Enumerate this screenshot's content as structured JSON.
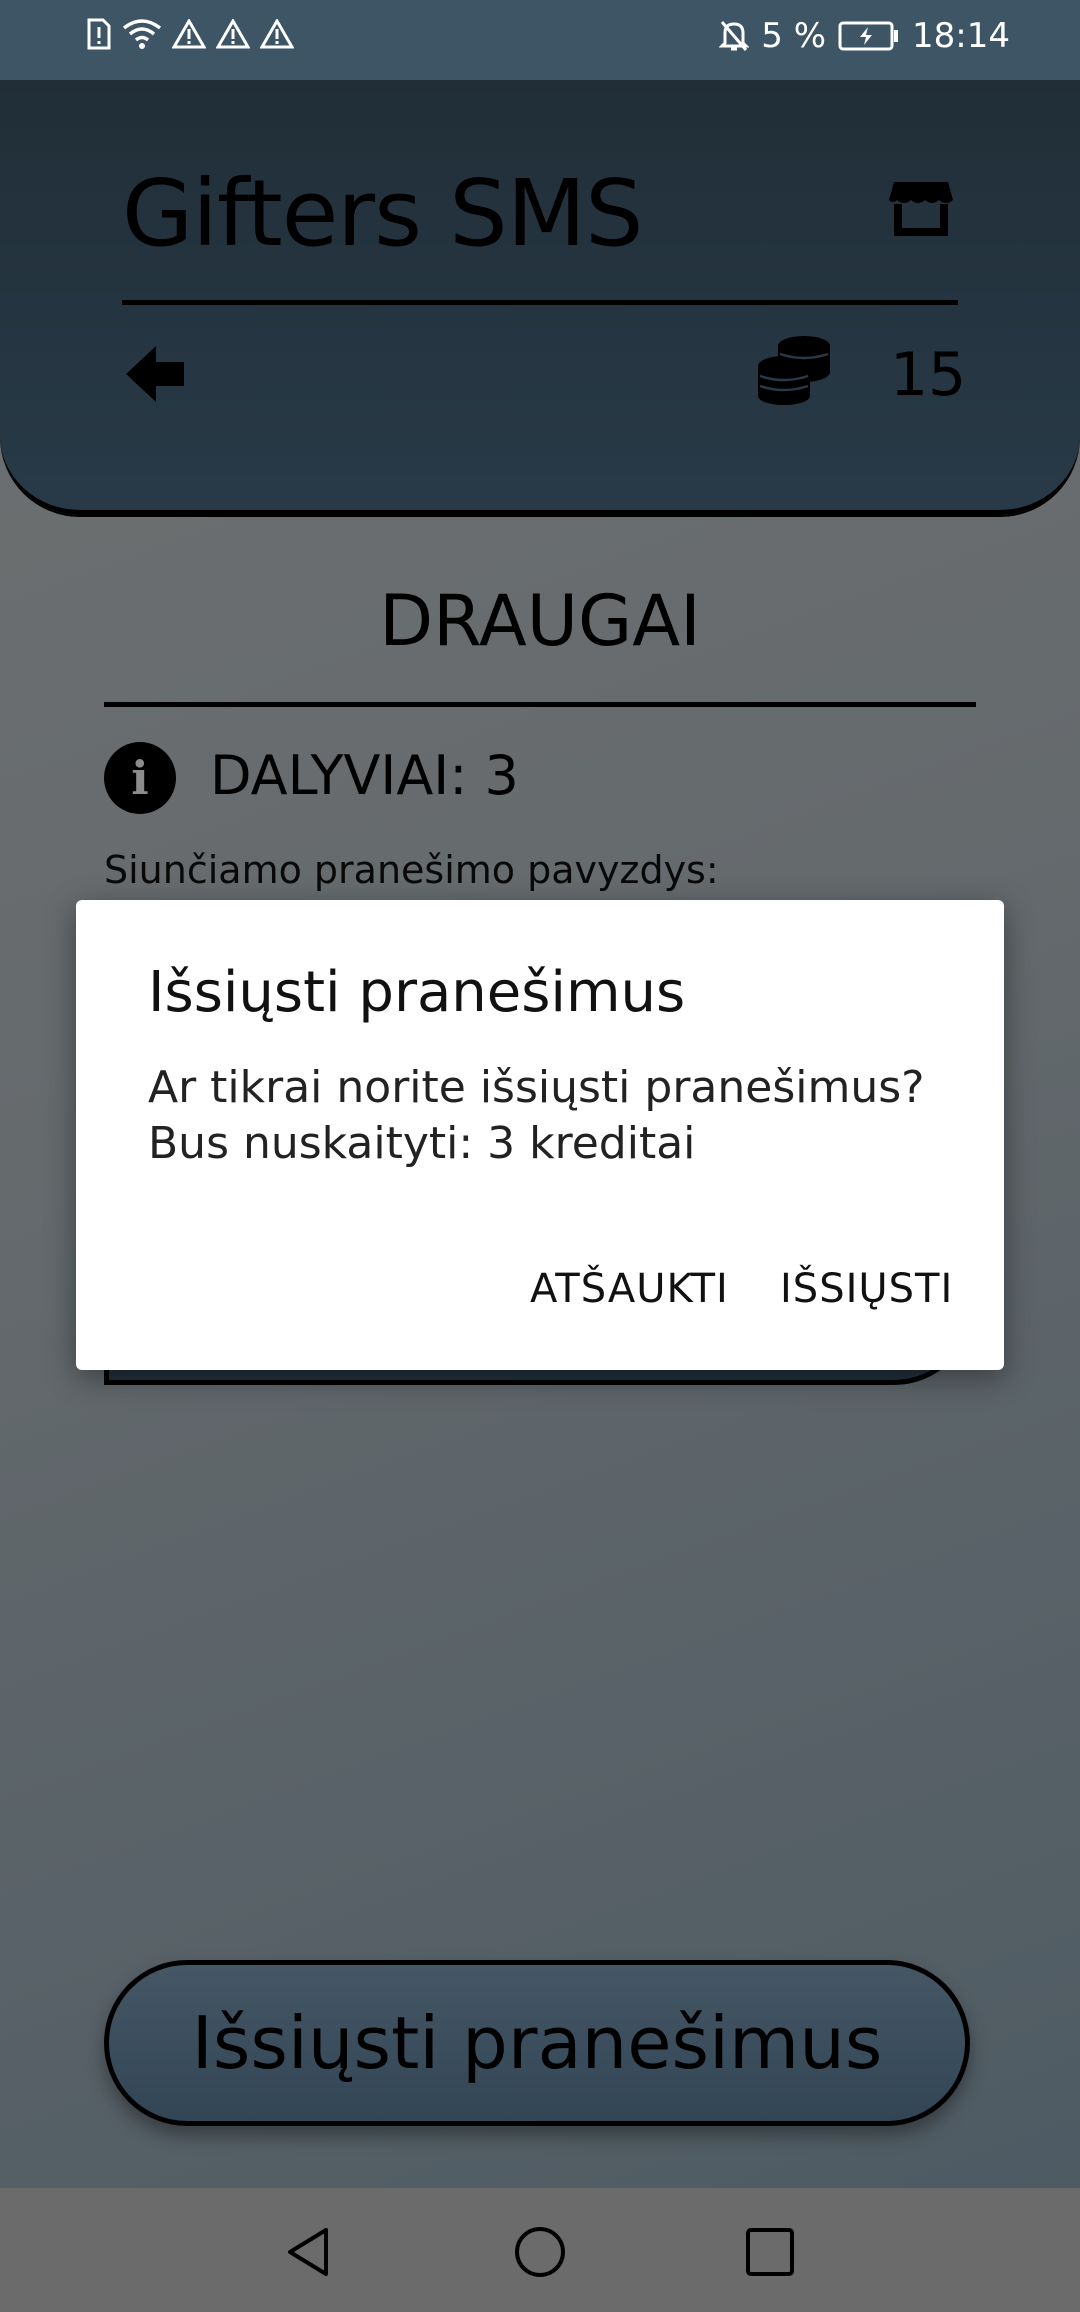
{
  "status_bar": {
    "battery_percent": "5 %",
    "time": "18:14"
  },
  "header": {
    "title": "Gifters SMS",
    "credits": "15"
  },
  "content": {
    "section_title": "DRAUGAI",
    "participants": "DALYVIAI: 3",
    "preview_label": "Siunčiamo pranešimo pavyzdys:",
    "send_button": "Išsiųsti pranešimus"
  },
  "dialog": {
    "title": "Išsiųsti pranešimus",
    "message_line1": "Ar tikrai norite išsiųsti pranešimus?",
    "message_line2": "Bus nuskaityti: 3 kreditai",
    "cancel_label": "ATŠAUKTI",
    "confirm_label": "IŠSIŲSTI"
  }
}
